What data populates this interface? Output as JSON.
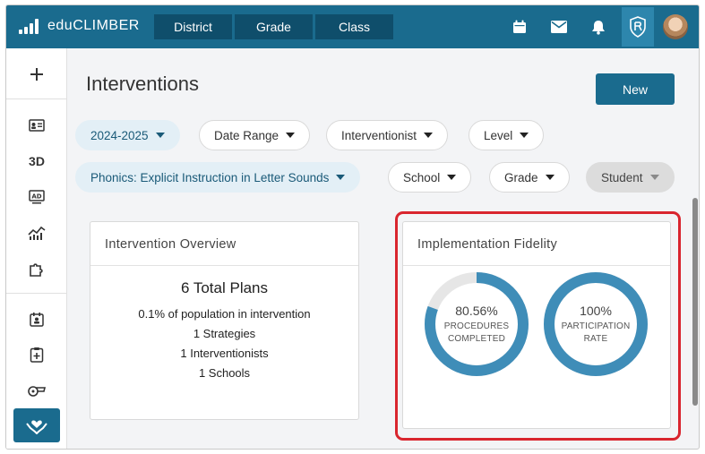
{
  "app": {
    "brand": "eduCLIMBER"
  },
  "nav": {
    "tabs": [
      {
        "label": "District"
      },
      {
        "label": "Grade"
      },
      {
        "label": "Class"
      }
    ]
  },
  "topbar_icons": [
    "calendar-icon",
    "mail-icon",
    "bell-icon",
    "shield-r-icon",
    "user-avatar"
  ],
  "sidebar": {
    "items": [
      {
        "icon": "plus-icon"
      },
      {
        "icon": "id-card-icon"
      },
      {
        "icon": "3d-label",
        "text": "3D"
      },
      {
        "icon": "ad-screen-icon"
      },
      {
        "icon": "chart-line-icon"
      },
      {
        "icon": "puzzle-icon"
      },
      {
        "icon": "calendar-user-icon"
      },
      {
        "icon": "clipboard-plus-icon"
      },
      {
        "icon": "whistle-icon"
      },
      {
        "icon": "hands-heart-icon"
      }
    ]
  },
  "page": {
    "title": "Interventions",
    "new_button": "New"
  },
  "filters": {
    "year": "2024-2025",
    "date_range": "Date Range",
    "interventionist": "Interventionist",
    "level": "Level",
    "strategy": "Phonics: Explicit Instruction in Letter Sounds",
    "school": "School",
    "grade": "Grade",
    "student": "Student"
  },
  "overview": {
    "title": "Intervention Overview",
    "total": "6 Total Plans",
    "lines": [
      "0.1% of population in intervention",
      "1 Strategies",
      "1 Interventionists",
      "1 Schools"
    ]
  },
  "fidelity": {
    "title": "Implementation Fidelity",
    "rings": [
      {
        "percent": "80.56%",
        "value": 80.56,
        "label_line1": "PROCEDURES",
        "label_line2": "COMPLETED"
      },
      {
        "percent": "100%",
        "value": 100,
        "label_line1": "PARTICIPATION",
        "label_line2": "RATE"
      }
    ]
  },
  "colors": {
    "brand": "#1a6b8e",
    "ring_fill": "#3f8db8",
    "ring_track": "#e6e6e6",
    "highlight": "#d9252e"
  }
}
